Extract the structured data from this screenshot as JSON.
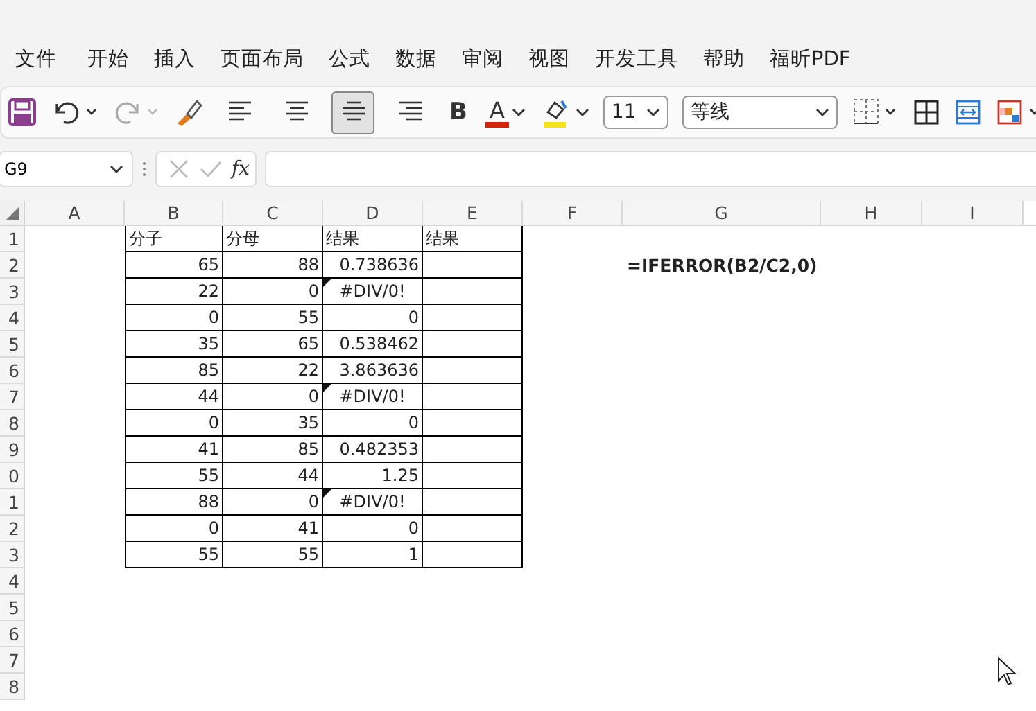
{
  "menu": [
    {
      "label": "文件"
    },
    {
      "label": "开始"
    },
    {
      "label": "插入"
    },
    {
      "label": "页面布局"
    },
    {
      "label": "公式"
    },
    {
      "label": "数据"
    },
    {
      "label": "审阅"
    },
    {
      "label": "视图"
    },
    {
      "label": "开发工具"
    },
    {
      "label": "帮助"
    },
    {
      "label": "福昕PDF"
    }
  ],
  "toolbar": {
    "align_buttons": [
      {
        "kind": "left",
        "selected": false
      },
      {
        "kind": "center",
        "selected": false
      },
      {
        "kind": "middle",
        "selected": true
      },
      {
        "kind": "right",
        "selected": false
      }
    ],
    "bold_label": "B",
    "font_color_label": "A",
    "font_size": "11",
    "font_name": "等线"
  },
  "formula_bar": {
    "name_box": "G9",
    "fx_label": "fx"
  },
  "sheet": {
    "columns": [
      "A",
      "B",
      "C",
      "D",
      "E",
      "F",
      "G",
      "H",
      "I"
    ],
    "rows": [
      {
        "header": "1",
        "cells": [
          {
            "kind": "text",
            "text": "分子"
          },
          {
            "kind": "text",
            "text": "分母"
          },
          {
            "kind": "text",
            "text": "结果"
          },
          {
            "kind": "text",
            "text": "结果"
          }
        ]
      },
      {
        "header": "2",
        "cells": [
          {
            "kind": "number",
            "text": "65"
          },
          {
            "kind": "number",
            "text": "88"
          },
          {
            "kind": "number",
            "text": "0.738636"
          },
          {
            "kind": "empty"
          }
        ],
        "note": "=IFERROR(B2/C2,0)"
      },
      {
        "header": "3",
        "cells": [
          {
            "kind": "number",
            "text": "22"
          },
          {
            "kind": "number",
            "text": "0"
          },
          {
            "kind": "error",
            "text": "#DIV/0!"
          },
          {
            "kind": "empty"
          }
        ]
      },
      {
        "header": "4",
        "cells": [
          {
            "kind": "number",
            "text": "0"
          },
          {
            "kind": "number",
            "text": "55"
          },
          {
            "kind": "number",
            "text": "0"
          },
          {
            "kind": "empty"
          }
        ]
      },
      {
        "header": "5",
        "cells": [
          {
            "kind": "number",
            "text": "35"
          },
          {
            "kind": "number",
            "text": "65"
          },
          {
            "kind": "number",
            "text": "0.538462"
          },
          {
            "kind": "empty"
          }
        ]
      },
      {
        "header": "6",
        "cells": [
          {
            "kind": "number",
            "text": "85"
          },
          {
            "kind": "number",
            "text": "22"
          },
          {
            "kind": "number",
            "text": "3.863636"
          },
          {
            "kind": "empty"
          }
        ]
      },
      {
        "header": "7",
        "cells": [
          {
            "kind": "number",
            "text": "44"
          },
          {
            "kind": "number",
            "text": "0"
          },
          {
            "kind": "error",
            "text": "#DIV/0!"
          },
          {
            "kind": "empty"
          }
        ]
      },
      {
        "header": "8",
        "cells": [
          {
            "kind": "number",
            "text": "0"
          },
          {
            "kind": "number",
            "text": "35"
          },
          {
            "kind": "number",
            "text": "0"
          },
          {
            "kind": "empty"
          }
        ]
      },
      {
        "header": "9",
        "cells": [
          {
            "kind": "number",
            "text": "41"
          },
          {
            "kind": "number",
            "text": "85"
          },
          {
            "kind": "number",
            "text": "0.482353"
          },
          {
            "kind": "empty"
          }
        ]
      },
      {
        "header": "0",
        "cells": [
          {
            "kind": "number",
            "text": "55"
          },
          {
            "kind": "number",
            "text": "44"
          },
          {
            "kind": "number",
            "text": "1.25"
          },
          {
            "kind": "empty"
          }
        ]
      },
      {
        "header": "1",
        "cells": [
          {
            "kind": "number",
            "text": "88"
          },
          {
            "kind": "number",
            "text": "0"
          },
          {
            "kind": "error",
            "text": "#DIV/0!"
          },
          {
            "kind": "empty"
          }
        ]
      },
      {
        "header": "2",
        "cells": [
          {
            "kind": "number",
            "text": "0"
          },
          {
            "kind": "number",
            "text": "41"
          },
          {
            "kind": "number",
            "text": "0"
          },
          {
            "kind": "empty"
          }
        ]
      },
      {
        "header": "3",
        "cells": [
          {
            "kind": "number",
            "text": "55"
          },
          {
            "kind": "number",
            "text": "55"
          },
          {
            "kind": "number",
            "text": "1"
          },
          {
            "kind": "empty"
          }
        ]
      },
      {
        "header": "4"
      },
      {
        "header": "5"
      },
      {
        "header": "6"
      },
      {
        "header": "7"
      },
      {
        "header": "8"
      }
    ]
  }
}
